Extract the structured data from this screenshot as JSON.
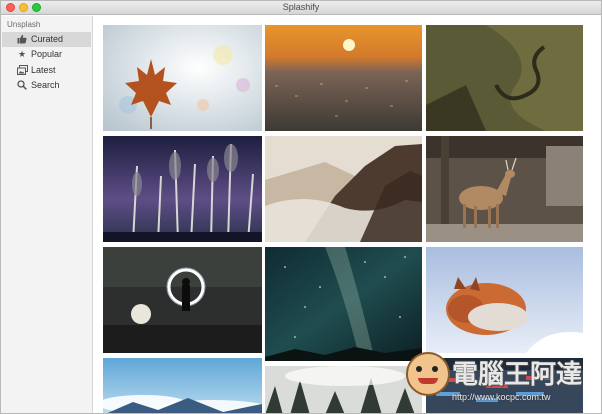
{
  "window": {
    "title": "Splashify"
  },
  "sidebar": {
    "section_title": "Unsplash",
    "items": [
      {
        "label": "Curated",
        "icon": "thumbs-up-icon",
        "active": true
      },
      {
        "label": "Popular",
        "icon": "star-icon",
        "active": false
      },
      {
        "label": "Latest",
        "icon": "image-stack-icon",
        "active": false
      },
      {
        "label": "Search",
        "icon": "search-icon",
        "active": false
      }
    ]
  },
  "photos": [
    {
      "subject": "maple-leaf"
    },
    {
      "subject": "city-sunset"
    },
    {
      "subject": "mountain-road"
    },
    {
      "subject": "night-forest"
    },
    {
      "subject": "cloudy-mountains"
    },
    {
      "subject": "deer"
    },
    {
      "subject": "light-ring"
    },
    {
      "subject": "milky-way"
    },
    {
      "subject": "sleeping-fox"
    },
    {
      "subject": "sky-clouds"
    },
    {
      "subject": "forest-fog"
    },
    {
      "subject": "stadium"
    }
  ],
  "watermark": {
    "text": "電腦王阿達",
    "url": "http://www.kocpc.com.tw"
  }
}
